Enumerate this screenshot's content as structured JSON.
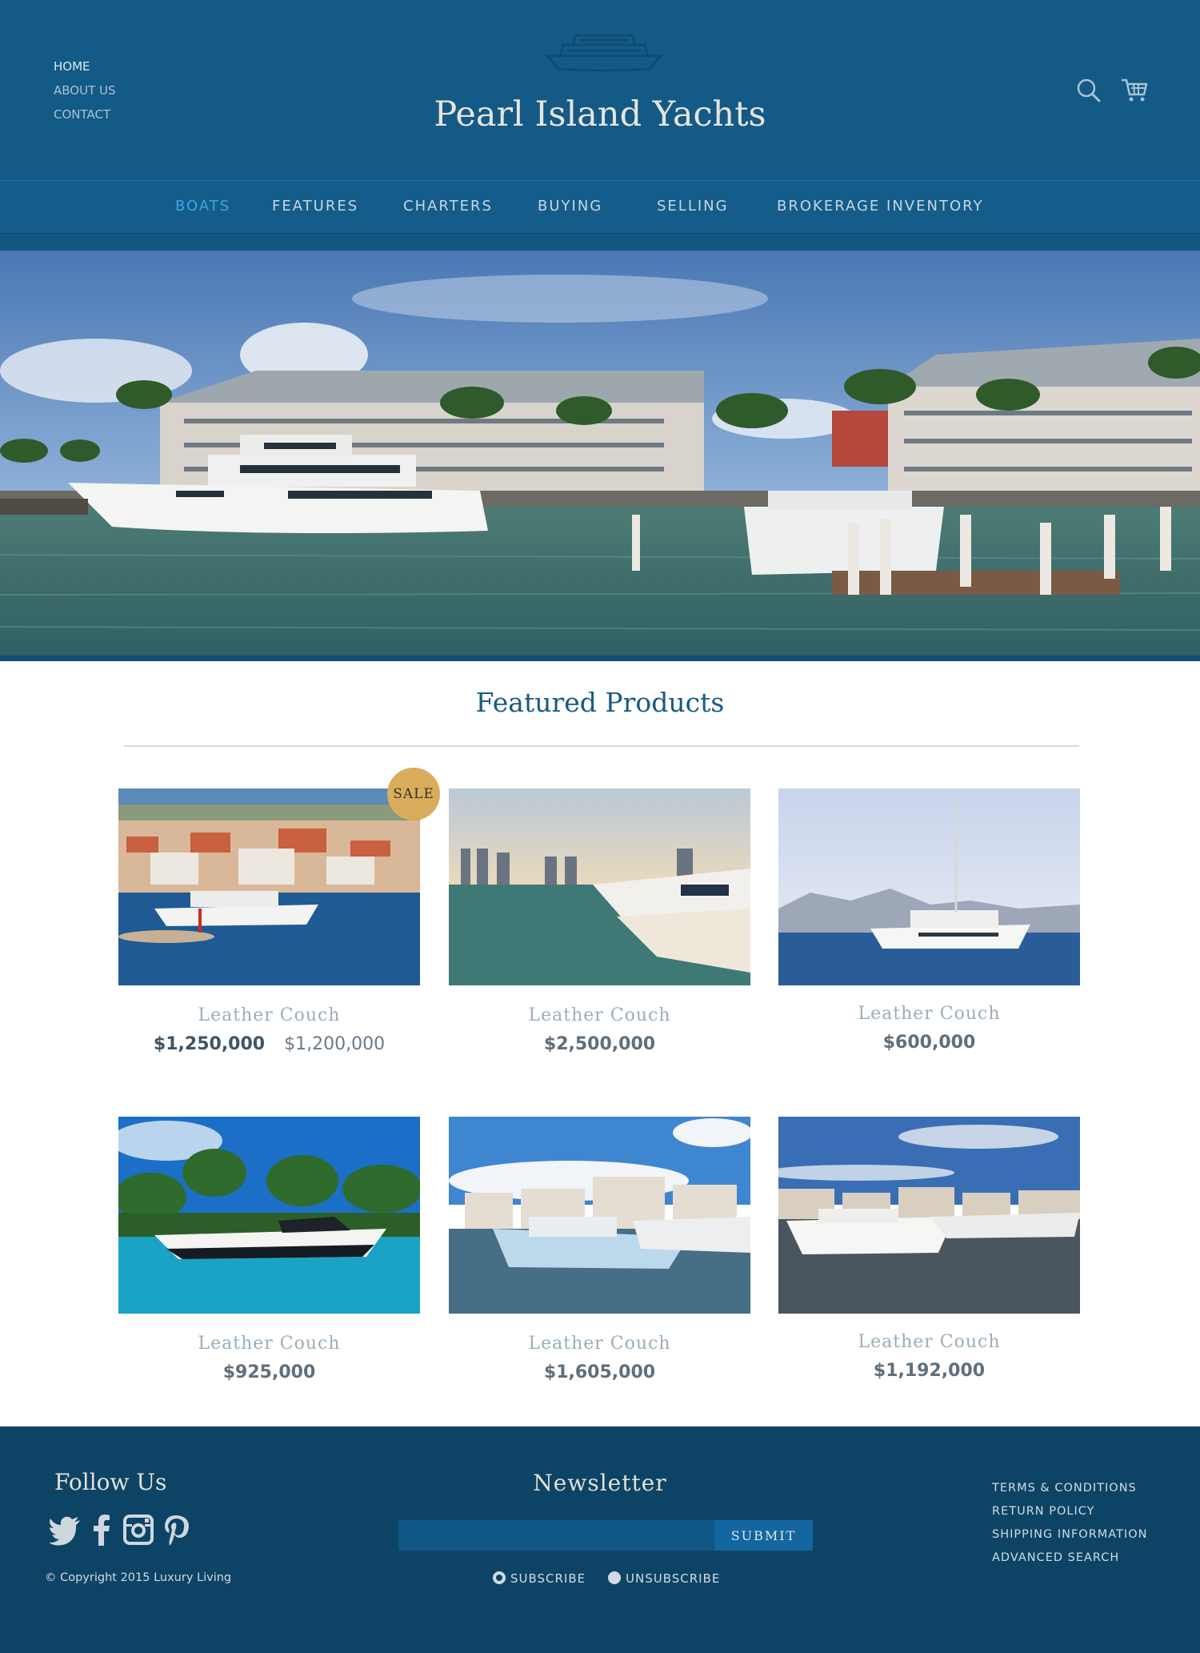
{
  "header": {
    "top_links": [
      "HOME",
      "ABOUT US",
      "CONTACT"
    ],
    "brand": "Pearl Island Yachts",
    "icons": [
      "ship-logo-icon",
      "search-icon",
      "cart-icon"
    ],
    "nav": [
      {
        "label": "BOATS",
        "active": true
      },
      {
        "label": "FEATURES",
        "active": false
      },
      {
        "label": "CHARTERS",
        "active": false
      },
      {
        "label": "BUYING",
        "active": false
      },
      {
        "label": "SELLING",
        "active": false
      },
      {
        "label": "BROKERAGE INVENTORY",
        "active": false
      }
    ]
  },
  "featured": {
    "title": "Featured Products",
    "sale_badge": "SALE",
    "products": [
      {
        "name": "Leather Couch",
        "old_price": "$1,250,000",
        "price": "$1,200,000",
        "on_sale": true
      },
      {
        "name": "Leather Couch",
        "price": "$2,500,000",
        "on_sale": false
      },
      {
        "name": "Leather Couch",
        "price": "$600,000",
        "on_sale": false
      },
      {
        "name": "Leather Couch",
        "price": "$925,000",
        "on_sale": false
      },
      {
        "name": "Leather Couch",
        "price": "$1,605,000",
        "on_sale": false
      },
      {
        "name": "Leather Couch",
        "price": "$1,192,000",
        "on_sale": false
      }
    ]
  },
  "footer": {
    "follow_title": "Follow Us",
    "social_icons": [
      "twitter-icon",
      "facebook-icon",
      "instagram-icon",
      "pinterest-icon"
    ],
    "copyright": "© Copyright 2015 Luxury Living",
    "newsletter": {
      "title": "Newsletter",
      "input_value": "",
      "input_placeholder": "",
      "submit_label": "SUBMIT",
      "options": [
        {
          "label": "SUBSCRIBE",
          "selected": true
        },
        {
          "label": "UNSUBSCRIBE",
          "selected": false
        }
      ]
    },
    "links": [
      "TERMS & CONDITIONS",
      "RETURN POLICY",
      "SHIPPING INFORMATION",
      "ADVANCED SEARCH"
    ]
  },
  "colors": {
    "header_bg": "#135a86",
    "accent": "#3ea6e0",
    "title_blue": "#175a82",
    "footer_bg": "#0d4466",
    "sale_gold": "#d9ad5c"
  }
}
